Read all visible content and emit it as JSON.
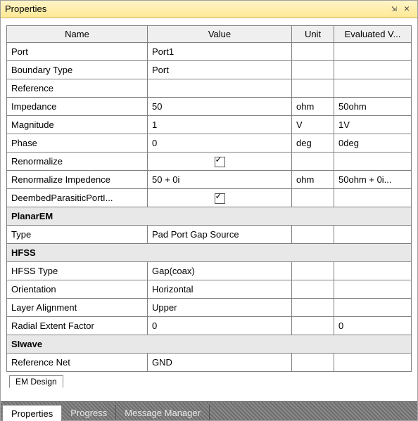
{
  "window": {
    "title": "Properties"
  },
  "columns": {
    "name": "Name",
    "value": "Value",
    "unit": "Unit",
    "evaluated": "Evaluated V..."
  },
  "rows": [
    {
      "kind": "prop",
      "name": "Port",
      "value": "Port1",
      "unit": "",
      "eval": ""
    },
    {
      "kind": "prop",
      "name": "Boundary Type",
      "value": "Port",
      "unit": "",
      "eval": ""
    },
    {
      "kind": "prop",
      "name": "Reference",
      "value": "",
      "unit": "",
      "eval": ""
    },
    {
      "kind": "prop",
      "name": "Impedance",
      "value": "50",
      "unit": "ohm",
      "eval": "50ohm"
    },
    {
      "kind": "prop",
      "name": "Magnitude",
      "value": "1",
      "unit": "V",
      "eval": "1V"
    },
    {
      "kind": "prop",
      "name": "Phase",
      "value": "0",
      "unit": "deg",
      "eval": "0deg"
    },
    {
      "kind": "check",
      "name": "Renormalize",
      "checked": true,
      "unit": "",
      "eval": ""
    },
    {
      "kind": "prop",
      "name": "Renormalize Impedence",
      "value": "50 + 0i",
      "unit": "ohm",
      "eval": "50ohm + 0i..."
    },
    {
      "kind": "check",
      "name": "DeembedParasiticPortI...",
      "checked": true,
      "unit": "",
      "eval": ""
    },
    {
      "kind": "section",
      "name": "PlanarEM"
    },
    {
      "kind": "prop",
      "name": "Type",
      "value": "Pad Port Gap Source",
      "unit": "",
      "eval": ""
    },
    {
      "kind": "section",
      "name": "HFSS"
    },
    {
      "kind": "prop",
      "name": "HFSS Type",
      "value": "Gap(coax)",
      "unit": "",
      "eval": ""
    },
    {
      "kind": "prop",
      "name": "Orientation",
      "value": "Horizontal",
      "unit": "",
      "eval": ""
    },
    {
      "kind": "prop",
      "name": "Layer Alignment",
      "value": "Upper",
      "unit": "",
      "eval": ""
    },
    {
      "kind": "prop",
      "name": "Radial Extent Factor",
      "value": "0",
      "unit": "",
      "eval": "0"
    },
    {
      "kind": "section",
      "name": "SIwave"
    },
    {
      "kind": "prop",
      "name": "Reference Net",
      "value": "GND",
      "unit": "",
      "eval": ""
    }
  ],
  "inner_tab": "EM Design",
  "bottom_tabs": {
    "properties": "Properties",
    "progress": "Progress",
    "message": "Message Manager"
  }
}
